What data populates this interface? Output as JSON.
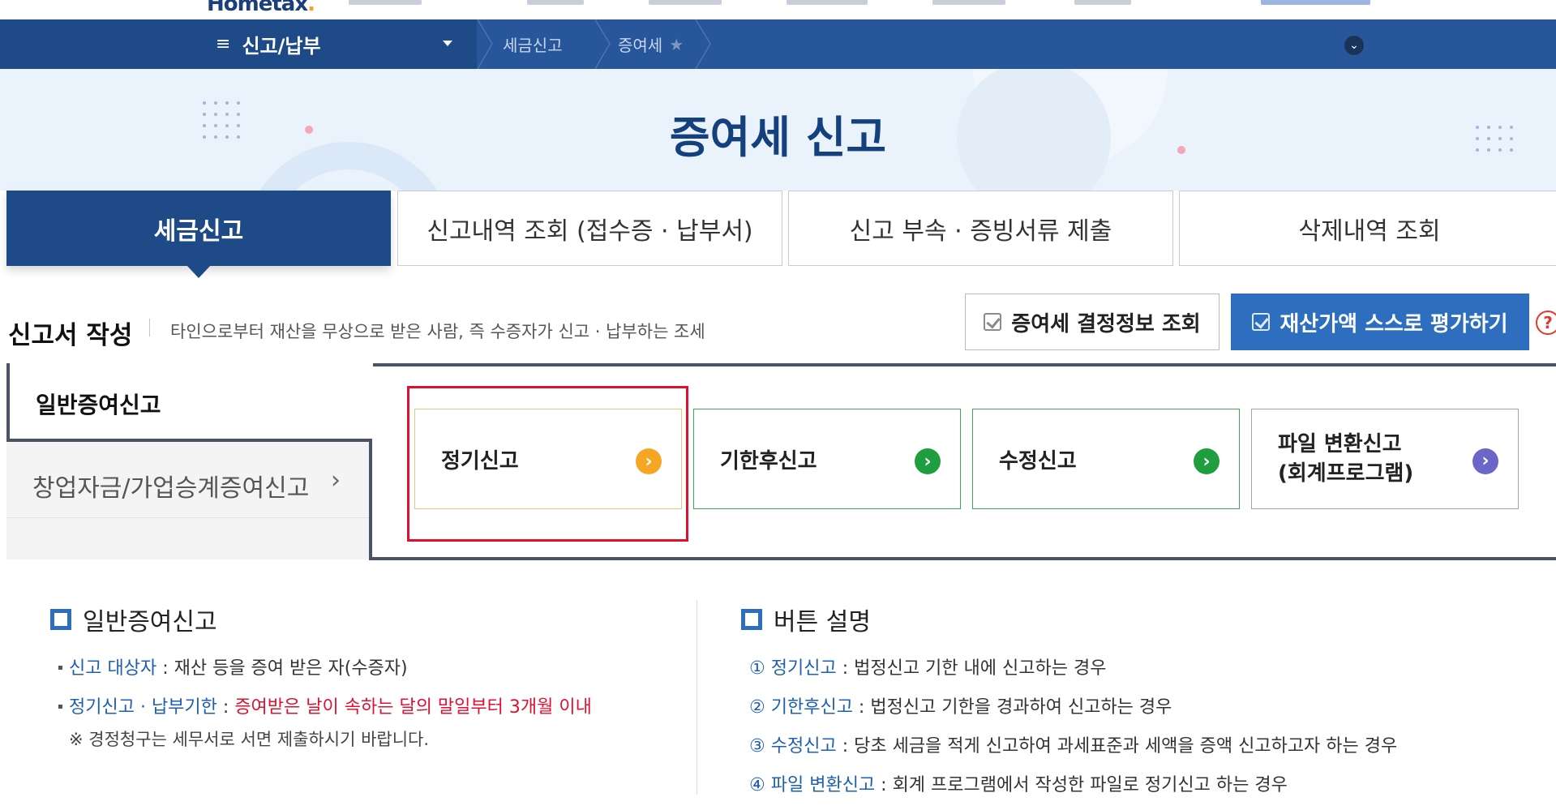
{
  "topbar": {
    "logo_text": "Hometax",
    "logo_suffix": "."
  },
  "navbar": {
    "menu_label": "신고/납부",
    "menu_icon": "hamburger-icon",
    "breadcrumb": [
      "세금신고",
      "증여세"
    ],
    "star_icon": "star-icon",
    "expand_icon": "chevron-down-icon"
  },
  "hero": {
    "title": "증여세 신고"
  },
  "tabs": [
    {
      "label": "세금신고",
      "active": true
    },
    {
      "label": "신고내역 조회 (접수증 · 납부서)",
      "active": false
    },
    {
      "label": "신고 부속 · 증빙서류 제출",
      "active": false
    },
    {
      "label": "삭제내역 조회",
      "active": false
    }
  ],
  "section": {
    "title": "신고서 작성",
    "description": "타인으로부터 재산을 무상으로 받은 사람, 즉 수증자가 신고 · 납부하는 조세"
  },
  "buttons": {
    "decision_lookup": "증여세 결정정보 조회",
    "self_evaluate": "재산가액 스스로 평가하기",
    "help": "?"
  },
  "sidebar": {
    "items": [
      {
        "label": "일반증여신고",
        "active": true
      },
      {
        "label": "창업자금/가업승계증여신고",
        "active": false,
        "arrow": "›"
      }
    ]
  },
  "cards": [
    {
      "label": "정기신고",
      "color": "#f5a623",
      "border": "#e8c87a",
      "highlighted": true
    },
    {
      "label": "기한후신고",
      "color": "#1e9e3e",
      "border": "#3daa5a",
      "highlighted": false
    },
    {
      "label": "수정신고",
      "color": "#1e9e3e",
      "border": "#3daa5a",
      "highlighted": false
    },
    {
      "label_line1": "파일 변환신고",
      "label_line2": "(회계프로그램)",
      "color": "#6b67c9",
      "border": "#9aa3b8",
      "highlighted": false
    }
  ],
  "info_left": {
    "title": "일반증여신고",
    "target_label": "신고 대상자",
    "target_text": " : 재산 등을 증여 받은 자(수증자)",
    "deadline_label": "정기신고 · 납부기한",
    "deadline_sep": " : ",
    "deadline_text": "증여받은 날이 속하는 달의 말일부터 3개월 이내",
    "note": "※ 경정청구는 세무서로 서면 제출하시기 바랍니다."
  },
  "info_right": {
    "title": "버튼 설명",
    "items": [
      {
        "num": "①",
        "label": "정기신고",
        "text": " : 법정신고 기한 내에 신고하는 경우"
      },
      {
        "num": "②",
        "label": "기한후신고",
        "text": " : 법정신고 기한을 경과하여 신고하는 경우"
      },
      {
        "num": "③",
        "label": "수정신고",
        "text": " : 당초 세금을 적게 신고하여 과세표준과 세액을 증액 신고하고자 하는 경우"
      },
      {
        "num": "④",
        "label": "파일 변환신고",
        "text": " : 회계 프로그램에서 작성한 파일로 정기신고 하는 경우"
      }
    ]
  },
  "colors": {
    "navy": "#1f4a88",
    "nav_blue": "#27569b",
    "accent_blue": "#2d6ebf",
    "red": "#e0102f"
  }
}
